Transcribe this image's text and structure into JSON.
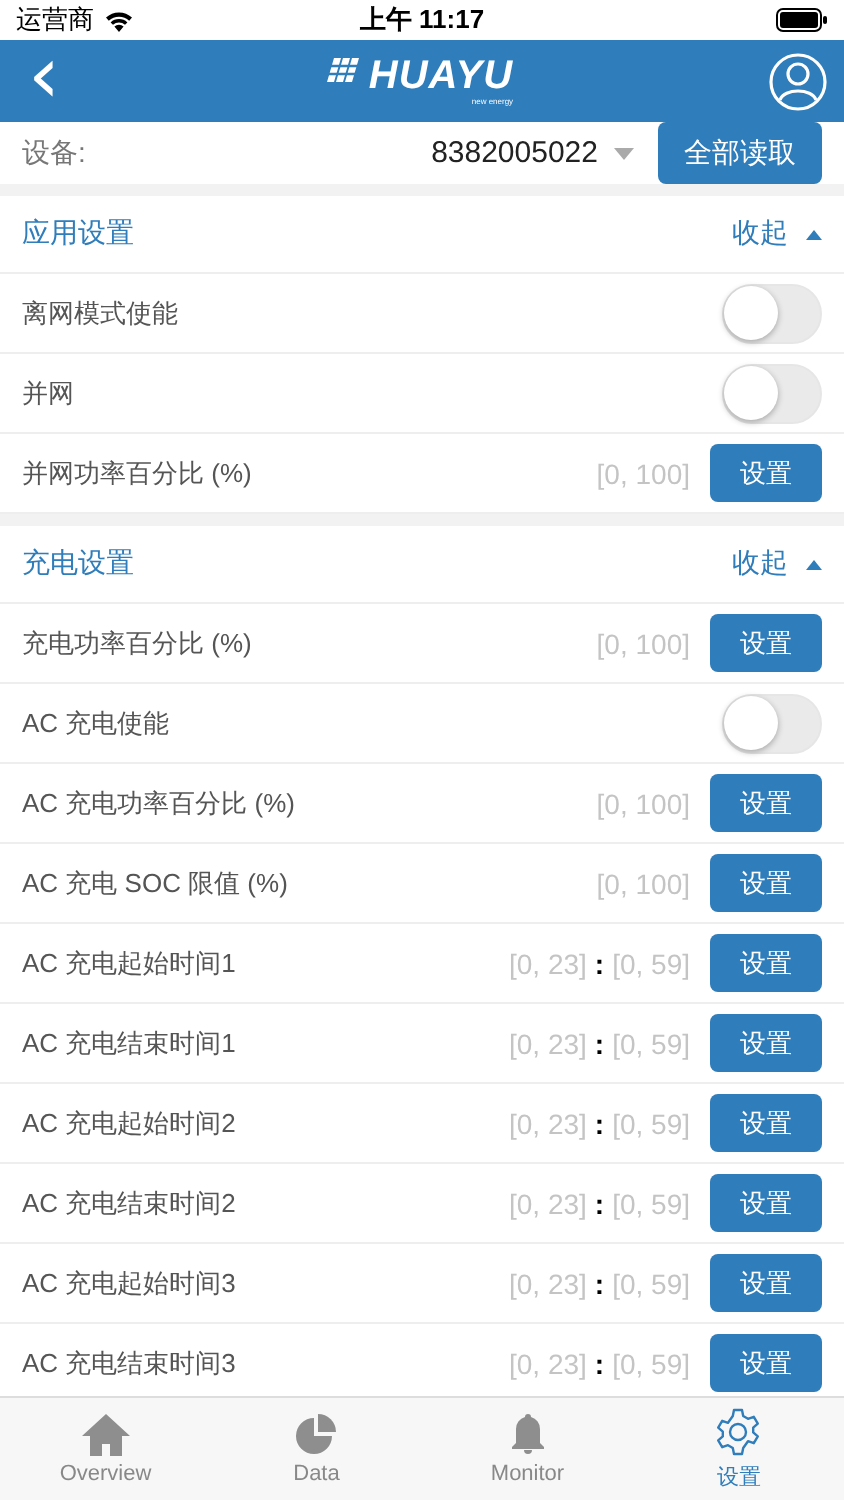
{
  "status_bar": {
    "carrier": "运营商",
    "time": "上午 11:17"
  },
  "nav": {
    "back": "‹",
    "logo_text": "HUAYU",
    "logo_tagline": "new energy"
  },
  "device": {
    "label": "设备:",
    "value": "8382005022",
    "read_all_button": "全部读取"
  },
  "sections": [
    {
      "title": "应用设置",
      "toggle_label": "收起",
      "expanded": true,
      "rows": [
        {
          "kind": "toggle",
          "label": "离网模式使能",
          "on": false
        },
        {
          "kind": "toggle",
          "label": "并网",
          "on": false
        },
        {
          "kind": "range",
          "label": "并网功率百分比 (%)",
          "range": "[0, 100]",
          "button": "设置"
        }
      ]
    },
    {
      "title": "充电设置",
      "toggle_label": "收起",
      "expanded": true,
      "rows": [
        {
          "kind": "range",
          "label": "充电功率百分比 (%)",
          "range": "[0, 100]",
          "button": "设置"
        },
        {
          "kind": "toggle",
          "label": "AC 充电使能",
          "on": false
        },
        {
          "kind": "range",
          "label": "AC 充电功率百分比 (%)",
          "range": "[0, 100]",
          "button": "设置"
        },
        {
          "kind": "range",
          "label": "AC 充电 SOC 限值 (%)",
          "range": "[0, 100]",
          "button": "设置"
        },
        {
          "kind": "time",
          "label": "AC 充电起始时间1",
          "hour_range": "[0, 23]",
          "separator": ":",
          "minute_range": "[0, 59]",
          "button": "设置"
        },
        {
          "kind": "time",
          "label": "AC 充电结束时间1",
          "hour_range": "[0, 23]",
          "separator": ":",
          "minute_range": "[0, 59]",
          "button": "设置"
        },
        {
          "kind": "time",
          "label": "AC 充电起始时间2",
          "hour_range": "[0, 23]",
          "separator": ":",
          "minute_range": "[0, 59]",
          "button": "设置"
        },
        {
          "kind": "time",
          "label": "AC 充电结束时间2",
          "hour_range": "[0, 23]",
          "separator": ":",
          "minute_range": "[0, 59]",
          "button": "设置"
        },
        {
          "kind": "time",
          "label": "AC 充电起始时间3",
          "hour_range": "[0, 23]",
          "separator": ":",
          "minute_range": "[0, 59]",
          "button": "设置"
        },
        {
          "kind": "time",
          "label": "AC 充电结束时间3",
          "hour_range": "[0, 23]",
          "separator": ":",
          "minute_range": "[0, 59]",
          "button": "设置"
        }
      ]
    }
  ],
  "tabs": [
    {
      "kind": "home",
      "label": "Overview",
      "selected": false
    },
    {
      "kind": "pie",
      "label": "Data",
      "selected": false
    },
    {
      "kind": "bell",
      "label": "Monitor",
      "selected": false
    },
    {
      "kind": "gear",
      "label": "设置",
      "selected": true
    }
  ]
}
